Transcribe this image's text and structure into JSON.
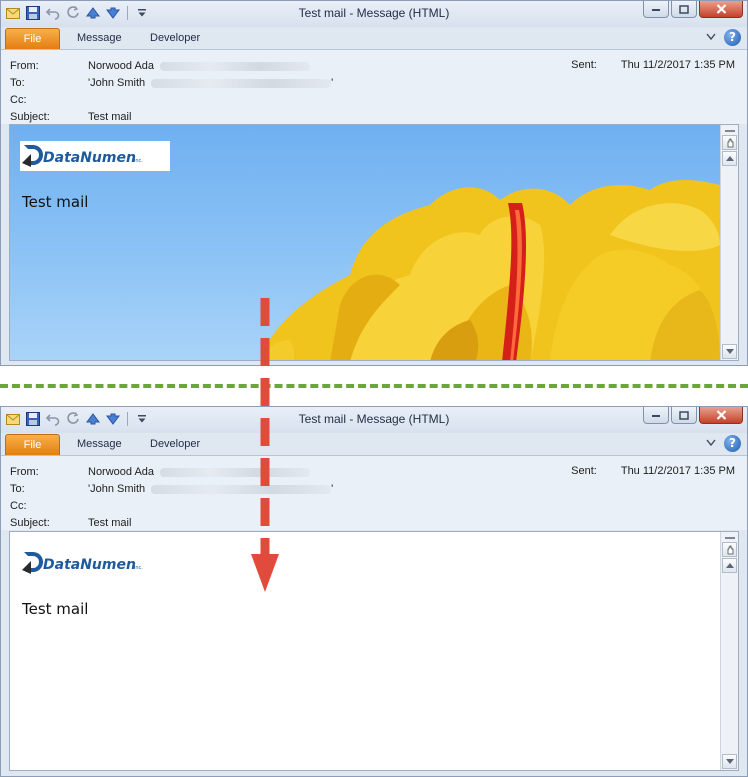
{
  "window": {
    "title": "Test mail  -  Message (HTML)"
  },
  "ribbon": {
    "tabs": [
      "File",
      "Message",
      "Developer"
    ]
  },
  "header": {
    "from_label": "From:",
    "from_value": "Norwood Ada",
    "to_label": "To:",
    "to_value": "'John Smith",
    "to_suffix": "'",
    "cc_label": "Cc:",
    "subject_label": "Subject:",
    "subject_value": "Test mail",
    "sent_label": "Sent:",
    "sent_value": "Thu 11/2/2017 1:35 PM"
  },
  "message": {
    "logo_text": "DataNumen",
    "logo_suffix": "inc.",
    "body_text": "Test mail"
  },
  "colors": {
    "file_tab": "#e57d13",
    "sky": "#6fb0f1",
    "divider": "#6aa63a",
    "arrow": "#e04b3c"
  }
}
